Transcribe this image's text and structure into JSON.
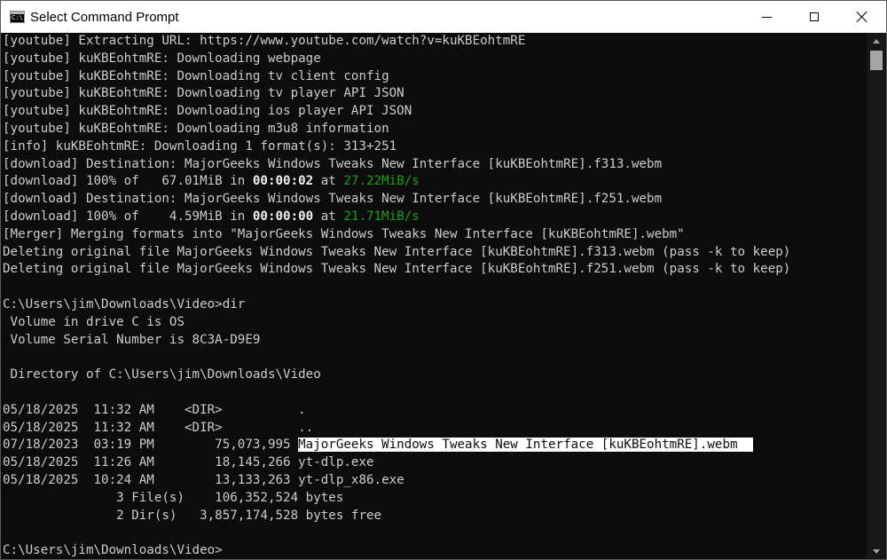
{
  "window": {
    "title": "Select Command Prompt",
    "icon_label": "C:\\."
  },
  "colors": {
    "console_bg": "#0c0c0c",
    "console_text": "#cccccc",
    "speed_green": "#13a10e",
    "selection_bg": "#ffffff"
  },
  "console": {
    "lines": [
      "[youtube] Extracting URL: https://www.youtube.com/watch?v=kuKBEohtmRE",
      "[youtube] kuKBEohtmRE: Downloading webpage",
      "[youtube] kuKBEohtmRE: Downloading tv client config",
      "[youtube] kuKBEohtmRE: Downloading tv player API JSON",
      "[youtube] kuKBEohtmRE: Downloading ios player API JSON",
      "[youtube] kuKBEohtmRE: Downloading m3u8 information",
      "[info] kuKBEohtmRE: Downloading 1 format(s): 313+251",
      "[download] Destination: MajorGeeks Windows Tweaks New Interface [kuKBEohtmRE].f313.webm"
    ],
    "progress1": {
      "prefix": "[download] 100% of   67.01MiB in ",
      "time": "00:00:02",
      "at": " at ",
      "speed": "27.22MiB/s"
    },
    "dest2": "[download] Destination: MajorGeeks Windows Tweaks New Interface [kuKBEohtmRE].f251.webm",
    "progress2": {
      "prefix": "[download] 100% of    4.59MiB in ",
      "time": "00:00:00",
      "at": " at ",
      "speed": "21.71MiB/s"
    },
    "lines_after": [
      "[Merger] Merging formats into \"MajorGeeks Windows Tweaks New Interface [kuKBEohtmRE].webm\"",
      "Deleting original file MajorGeeks Windows Tweaks New Interface [kuKBEohtmRE].f313.webm (pass -k to keep)",
      "Deleting original file MajorGeeks Windows Tweaks New Interface [kuKBEohtmRE].f251.webm (pass -k to keep)",
      "",
      "C:\\Users\\jim\\Downloads\\Video>dir",
      " Volume in drive C is OS",
      " Volume Serial Number is 8C3A-D9E9",
      "",
      " Directory of C:\\Users\\jim\\Downloads\\Video",
      "",
      "05/18/2025  11:32 AM    <DIR>          .",
      "05/18/2025  11:32 AM    <DIR>          .."
    ],
    "selected_row": {
      "prefix": "07/18/2023  03:19 PM        75,073,995 ",
      "selected": "MajorGeeks Windows Tweaks New Interface [kuKBEohtmRE].webm  "
    },
    "lines_end": [
      "05/18/2025  11:26 AM        18,145,266 yt-dlp.exe",
      "05/18/2025  10:24 AM        13,133,263 yt-dlp_x86.exe",
      "               3 File(s)    106,352,524 bytes",
      "               2 Dir(s)   3,857,174,528 bytes free",
      "",
      "C:\\Users\\jim\\Downloads\\Video>"
    ]
  }
}
